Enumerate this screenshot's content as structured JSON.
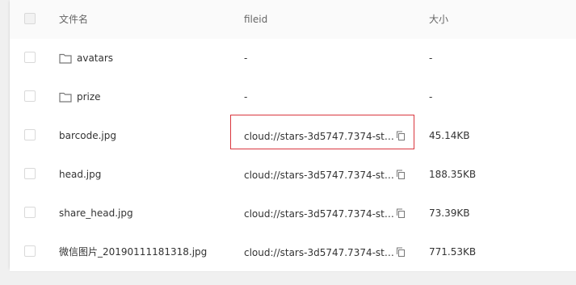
{
  "header": {
    "name": "文件名",
    "fileid": "fileid",
    "size": "大小"
  },
  "rows": [
    {
      "name": "avatars",
      "type": "folder",
      "fileid": "-",
      "size": "-"
    },
    {
      "name": "prize",
      "type": "folder",
      "fileid": "-",
      "size": "-"
    },
    {
      "name": "barcode.jpg",
      "type": "file",
      "fileid": "cloud://stars-3d5747.7374-stars-…",
      "size": "45.14KB"
    },
    {
      "name": "head.jpg",
      "type": "file",
      "fileid": "cloud://stars-3d5747.7374-stars-…",
      "size": "188.35KB"
    },
    {
      "name": "share_head.jpg",
      "type": "file",
      "fileid": "cloud://stars-3d5747.7374-stars-…",
      "size": "73.39KB"
    },
    {
      "name": "微信图片_20190111181318.jpg",
      "type": "file",
      "fileid": "cloud://stars-3d5747.7374-stars-…",
      "size": "771.53KB"
    }
  ],
  "icons": {
    "folder": "folder-icon",
    "copy": "copy-icon"
  },
  "colors": {
    "highlight": "#d9363e",
    "border": "#e8e8e8"
  }
}
